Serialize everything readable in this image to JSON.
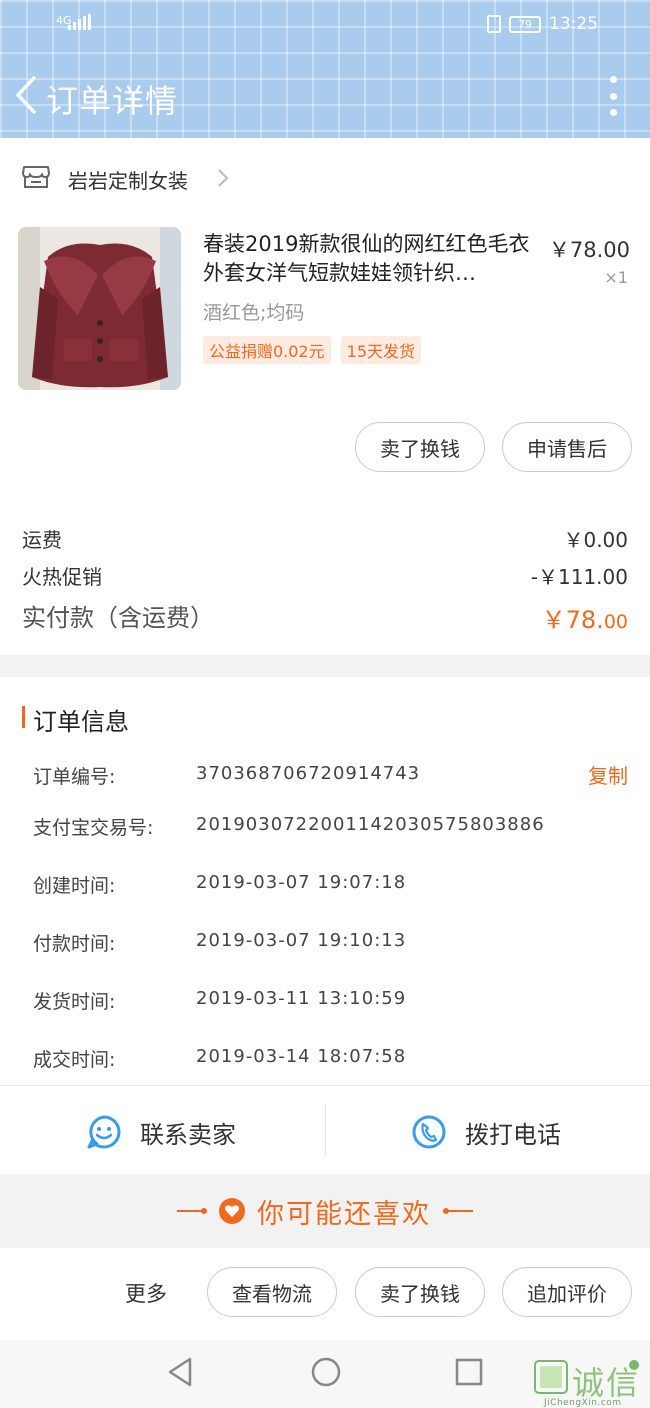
{
  "status_bar": {
    "signal": "4G",
    "battery": "79",
    "time": "13:25"
  },
  "nav": {
    "title": "订单详情"
  },
  "shop": {
    "name": "岩岩定制女装"
  },
  "product": {
    "title": "春装2019新款很仙的网红红色毛衣外套女洋气短款娃娃领针织…",
    "price": "￥78.00",
    "quantity": "×1",
    "sku": "酒红色;均码",
    "tags": [
      "公益捐赠0.02元",
      "15天发货"
    ]
  },
  "item_actions": {
    "sell_exchange": "卖了换钱",
    "after_sale": "申请售后"
  },
  "fees": {
    "shipping_label": "运费",
    "shipping_value": "￥0.00",
    "promo_label": "火热促销",
    "promo_value": "-￥111.00",
    "total_label": "实付款（含运费）",
    "total_value_main": "￥78.",
    "total_value_cents": "00"
  },
  "order_info": {
    "title": "订单信息",
    "copy_label": "复制",
    "rows": [
      {
        "label": "订单编号:",
        "value": "370368706720914743"
      },
      {
        "label": "支付宝交易号:",
        "value": "2019030722001142030575803886"
      },
      {
        "label": "创建时间:",
        "value": "2019-03-07 19:07:18"
      },
      {
        "label": "付款时间:",
        "value": "2019-03-07 19:10:13"
      },
      {
        "label": "发货时间:",
        "value": "2019-03-11 13:10:59"
      },
      {
        "label": "成交时间:",
        "value": "2019-03-14 18:07:58"
      }
    ]
  },
  "contact": {
    "seller": "联系卖家",
    "phone": "拨打电话"
  },
  "recommend": {
    "title": "你可能还喜欢"
  },
  "bottom_bar": {
    "more": "更多",
    "logistics": "查看物流",
    "sell_exchange": "卖了换钱",
    "add_review": "追加评价"
  },
  "watermark": {
    "text": "诚信",
    "url": "JiChengXin.com"
  },
  "colors": {
    "accent": "#f06a1e",
    "header": "#a9cbee",
    "icon_blue": "#3a9be8"
  }
}
